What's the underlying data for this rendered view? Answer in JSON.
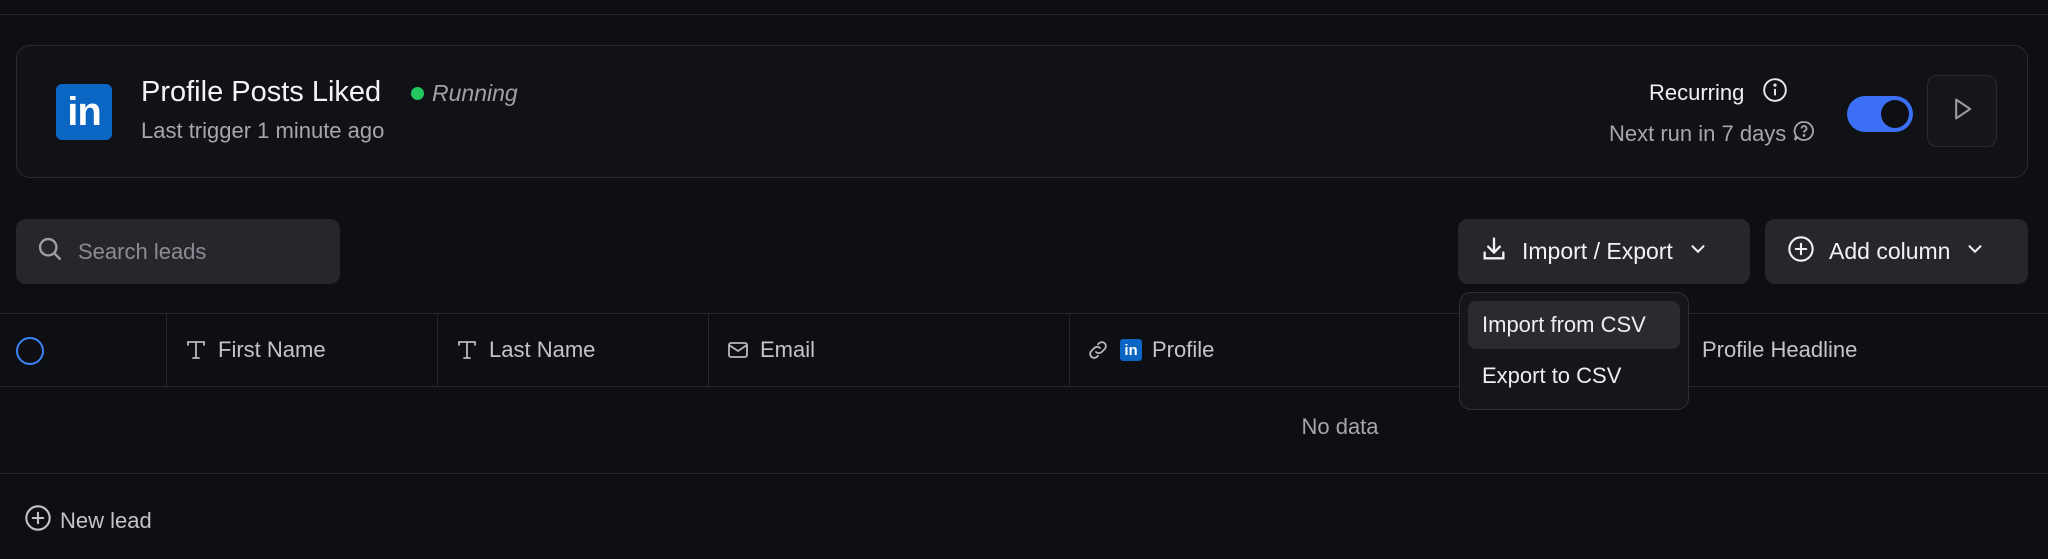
{
  "campaign": {
    "title": "Profile Posts Liked",
    "status": "Running",
    "last_trigger": "Last trigger 1 minute ago",
    "recurring_label": "Recurring",
    "next_run": "Next run in 7 days",
    "recurring_enabled": true,
    "logo_text": "in",
    "status_color": "#22c55e",
    "accent_color": "#3b6ff5"
  },
  "toolbar": {
    "search_placeholder": "Search leads",
    "import_export_label": "Import / Export",
    "add_column_label": "Add column"
  },
  "table": {
    "columns": [
      "First Name",
      "Last Name",
      "Email",
      "Profile",
      "Profile Headline"
    ],
    "empty_text": "No data"
  },
  "footer": {
    "new_lead_label": "New lead"
  },
  "dropdown": {
    "items": [
      "Import from CSV",
      "Export to CSV"
    ]
  }
}
